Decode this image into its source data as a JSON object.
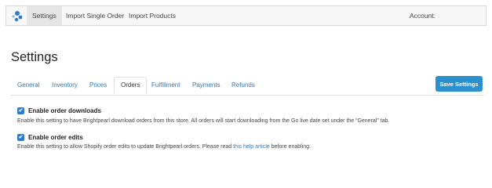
{
  "topnav": {
    "items": [
      {
        "label": "Settings",
        "active": true
      },
      {
        "label": "Import Single Order",
        "active": false
      },
      {
        "label": "Import Products",
        "active": false
      }
    ],
    "account_label": "Account:"
  },
  "page_title": "Settings",
  "tabs": [
    {
      "label": "General",
      "active": false
    },
    {
      "label": "Inventory",
      "active": false
    },
    {
      "label": "Prices",
      "active": false
    },
    {
      "label": "Orders",
      "active": true
    },
    {
      "label": "Fulfillment",
      "active": false
    },
    {
      "label": "Payments",
      "active": false
    },
    {
      "label": "Refunds",
      "active": false
    }
  ],
  "save_button": "Save Settings",
  "options": [
    {
      "label": "Enable order downloads",
      "checked": true,
      "description": "Enable this setting to have Brightpearl download orders from this store. All orders will start downloading from the Go live date set under the “General” tab."
    },
    {
      "label": "Enable order edits",
      "checked": true,
      "description_before": "Enable this setting to allow Shopify order edits to update Brightpearl orders. Please read ",
      "description_link": "this help article",
      "description_after": " before enabling."
    }
  ],
  "colors": {
    "accent": "#2d8fcb",
    "link": "#337ab7"
  }
}
